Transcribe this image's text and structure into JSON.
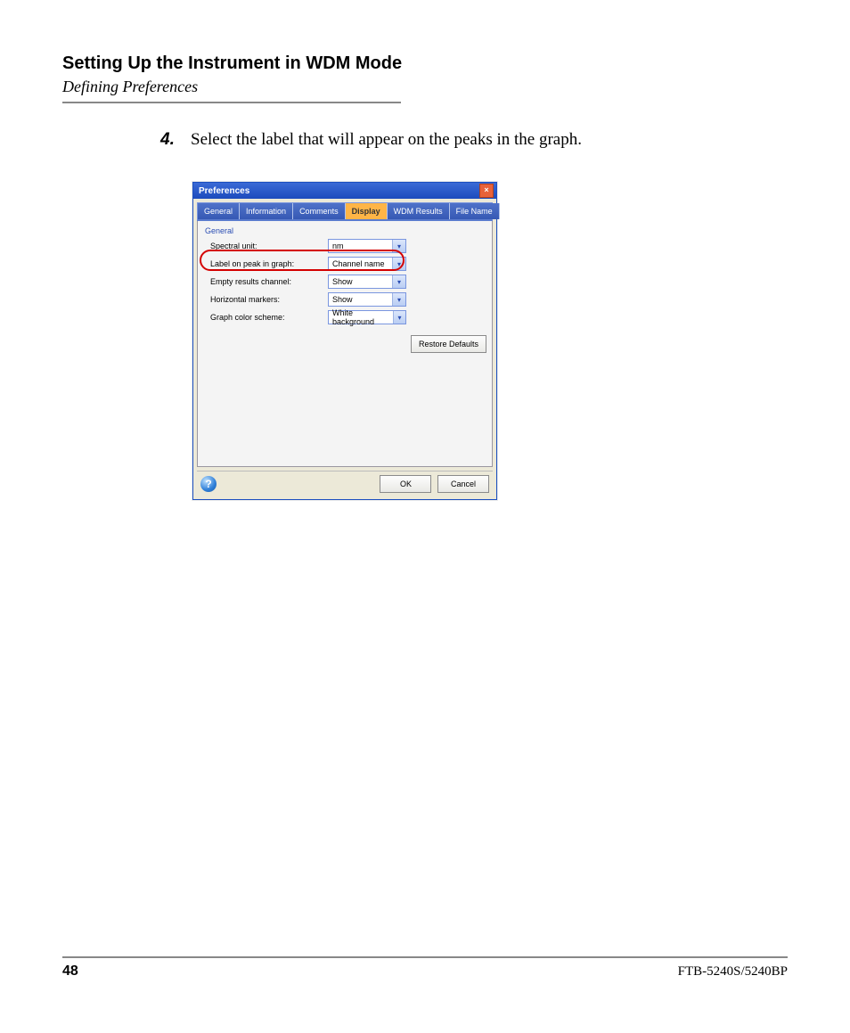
{
  "header": {
    "title": "Setting Up the Instrument in WDM Mode",
    "subtitle": "Defining Preferences"
  },
  "step": {
    "number": "4.",
    "text": "Select the label that will appear on the peaks in the graph."
  },
  "dialog": {
    "title": "Preferences",
    "close": "×",
    "tabs": [
      "General",
      "Information",
      "Comments",
      "Display",
      "WDM Results",
      "File Name"
    ],
    "active_tab_index": 3,
    "group_title": "General",
    "rows": [
      {
        "label": "Spectral unit:",
        "value": "nm"
      },
      {
        "label": "Label on peak in graph:",
        "value": "Channel name"
      },
      {
        "label": "Empty results channel:",
        "value": "Show"
      },
      {
        "label": "Horizontal markers:",
        "value": "Show"
      },
      {
        "label": "Graph color scheme:",
        "value": "White background"
      }
    ],
    "restore": "Restore Defaults",
    "help": "?",
    "ok": "OK",
    "cancel": "Cancel"
  },
  "footer": {
    "page": "48",
    "model": "FTB-5240S/5240BP"
  }
}
